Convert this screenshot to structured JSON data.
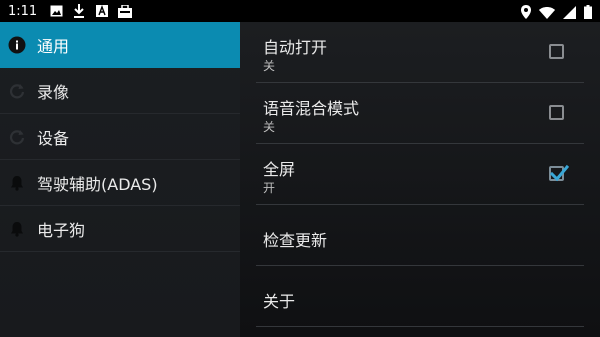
{
  "status_bar": {
    "time": "1:11",
    "left_icons": [
      "image-icon",
      "download-icon",
      "text-a-icon",
      "briefcase-icon"
    ],
    "right_icons": [
      "location-icon",
      "wifi-icon",
      "signal-icon",
      "battery-icon"
    ]
  },
  "sidebar": {
    "items": [
      {
        "label": "通用",
        "icon": "info-icon",
        "active": true
      },
      {
        "label": "录像",
        "icon": "refresh-icon",
        "active": false
      },
      {
        "label": "设备",
        "icon": "refresh-icon",
        "active": false
      },
      {
        "label": "驾驶辅助(ADAS)",
        "icon": "bell-icon",
        "active": false
      },
      {
        "label": "电子狗",
        "icon": "bell-icon",
        "active": false
      }
    ]
  },
  "preferences": [
    {
      "title": "自动打开",
      "summary": "关",
      "checkbox": true,
      "checked": false
    },
    {
      "title": "语音混合模式",
      "summary": "关",
      "checkbox": true,
      "checked": false
    },
    {
      "title": "全屏",
      "summary": "开",
      "checkbox": true,
      "checked": true
    },
    {
      "title": "检查更新",
      "summary": null,
      "checkbox": false
    },
    {
      "title": "关于",
      "summary": null,
      "checkbox": false
    }
  ],
  "colors": {
    "accent": "#0b8bb1",
    "checkmark": "#3aa7d6",
    "background": "#000000"
  }
}
